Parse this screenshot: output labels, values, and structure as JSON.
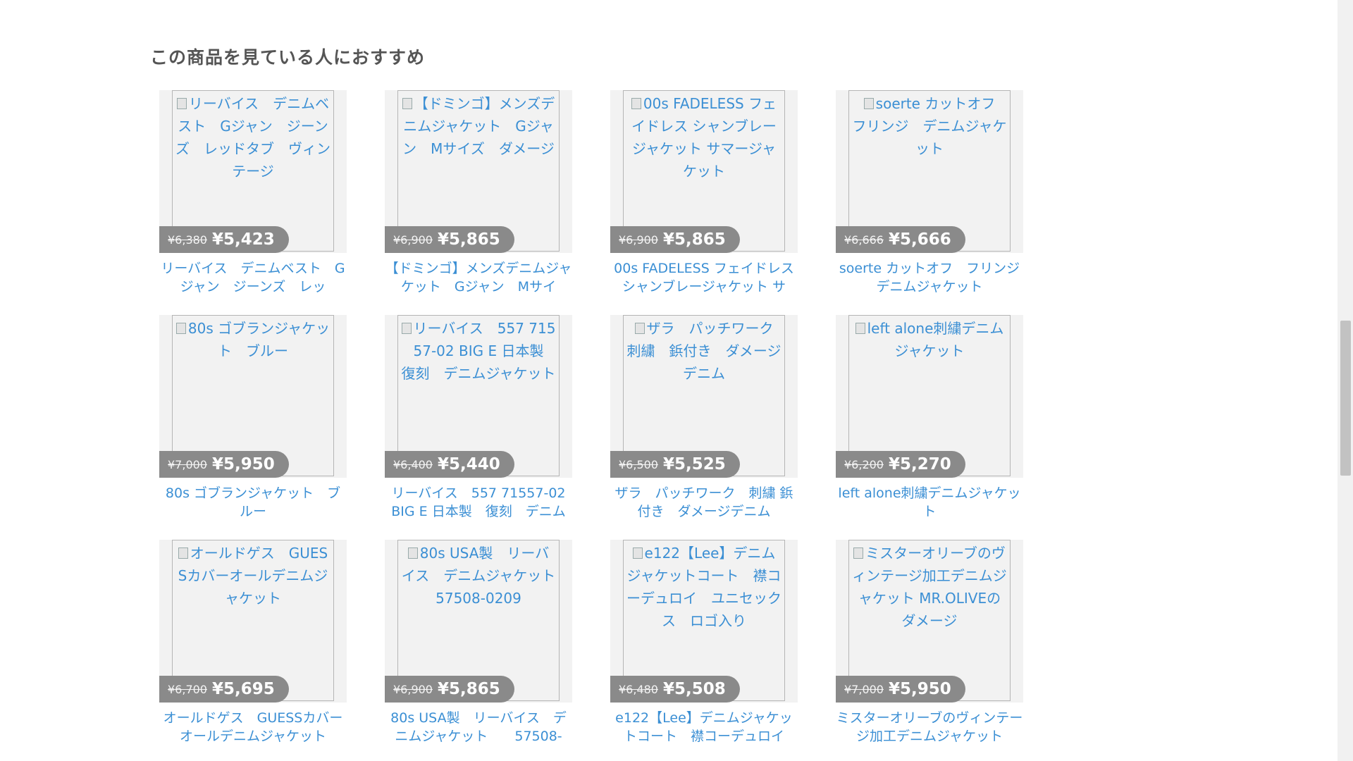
{
  "section": {
    "title": "この商品を見ている人におすすめ"
  },
  "products": [
    {
      "alt": "リーバイス　デニムベスト　Gジャン　ジーンズ　￹レッドタブ　ヴィンテージ",
      "old_price": "¥6,380",
      "price": "¥5,423",
      "name": "リーバイス　デニムベスト　Gジャン　ジーンズ　￹レッ"
    },
    {
      "alt": "【ドミンゴ】メンズデニムジャケット　Gジャン　Mサイズ　ダメージ",
      "old_price": "¥6,900",
      "price": "¥5,865",
      "name": "【ドミンゴ】メンズデニムジャケット　Gジャン　Mサイ"
    },
    {
      "alt": "00s FADELESS フェイドレス シャンブレージャケット サマージャケット",
      "old_price": "¥6,900",
      "price": "¥5,865",
      "name": "00s FADELESS フェイドレス シャンブレージャケット サ"
    },
    {
      "alt": "soerte カットオフ　フリンジ　デニムジャケット",
      "old_price": "¥6,666",
      "price": "¥5,666",
      "name": "soerte カットオフ　フリンジ デニムジャケット"
    },
    {
      "alt": "80s ゴブランジャケット　ブルー",
      "old_price": "¥7,000",
      "price": "¥5,950",
      "name": "80s ゴブランジャケット　ブルー"
    },
    {
      "alt": "リーバイス　557 71557-02 BIG E 日本製　復刻　デニムジャケット",
      "old_price": "¥6,400",
      "price": "¥5,440",
      "name": "リーバイス　557 71557-02 BIG E 日本製　復刻　デニム"
    },
    {
      "alt": "ザラ　パッチワーク　刺繍　鋲付き　ダメージデニム",
      "old_price": "¥6,500",
      "price": "¥5,525",
      "name": "ザラ　パッチワーク　刺繍 鋲付き　ダメージデニム"
    },
    {
      "alt": "left alone刺繍デニムジャケット",
      "old_price": "¥6,200",
      "price": "¥5,270",
      "name": "left alone刺繍デニムジャケット"
    },
    {
      "alt": "オールドゲス　GUESSカバーオールデニムジャケット",
      "old_price": "¥6,700",
      "price": "¥5,695",
      "name": "オールドゲス　GUESSカバーオールデニムジャケット"
    },
    {
      "alt": "80s USA製　リーバイス　デニムジャケット　57508-0209",
      "old_price": "¥6,900",
      "price": "¥5,865",
      "name": "80s USA製　リーバイス　デニムジャケット　　57508-"
    },
    {
      "alt": "e122【Lee】デニムジャケットコート　襟コーデュロイ　ユニセックス　ロゴ入り",
      "old_price": "¥6,480",
      "price": "¥5,508",
      "name": "e122【Lee】デニムジャケットコート　襟コーデュロイ"
    },
    {
      "alt": "ミスターオリーブのヴィンテージ加工デニムジャケット MR.OLIVEのダメージ",
      "old_price": "¥7,000",
      "price": "¥5,950",
      "name": "ミスターオリーブのヴィンテージ加工デニムジャケット"
    }
  ]
}
